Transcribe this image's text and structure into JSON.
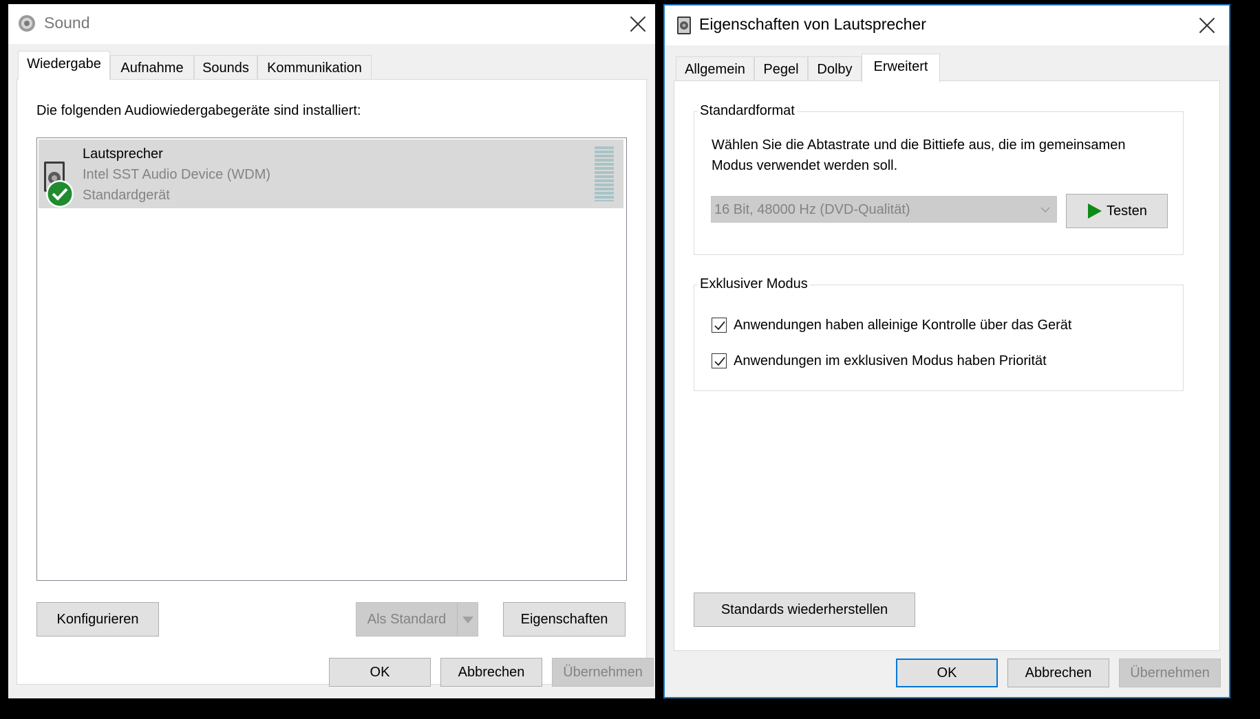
{
  "sound_dialog": {
    "title": "Sound",
    "tabs": [
      {
        "label": "Wiedergabe",
        "active": true
      },
      {
        "label": "Aufnahme",
        "active": false
      },
      {
        "label": "Sounds",
        "active": false
      },
      {
        "label": "Kommunikation",
        "active": false
      }
    ],
    "intro_text": "Die folgenden Audiowiedergabegeräte sind installiert:",
    "devices": [
      {
        "name": "Lautsprecher",
        "description": "Intel SST Audio Device (WDM)",
        "status": "Standardgerät",
        "icon": "speaker-icon",
        "status_icon": "default-device-check-icon"
      }
    ],
    "buttons": {
      "configure": "Konfigurieren",
      "set_default": "Als Standard",
      "properties": "Eigenschaften",
      "ok": "OK",
      "cancel": "Abbrechen",
      "apply": "Übernehmen"
    }
  },
  "properties_dialog": {
    "title": "Eigenschaften von Lautsprecher",
    "tabs": [
      {
        "label": "Allgemein",
        "active": false
      },
      {
        "label": "Pegel",
        "active": false
      },
      {
        "label": "Dolby",
        "active": false
      },
      {
        "label": "Erweitert",
        "active": true
      }
    ],
    "default_format": {
      "group_label": "Standardformat",
      "description_line1": "Wählen Sie die Abtastrate und die Bittiefe aus, die im gemeinsamen",
      "description_line2": "Modus verwendet werden soll.",
      "selected_format": "16 Bit, 48000 Hz (DVD-Qualität)",
      "test_button": "Testen"
    },
    "exclusive_mode": {
      "group_label": "Exklusiver Modus",
      "options": [
        {
          "label": "Anwendungen haben alleinige Kontrolle über das Gerät",
          "checked": true
        },
        {
          "label": "Anwendungen im exklusiven Modus haben Priorität",
          "checked": true
        }
      ]
    },
    "buttons": {
      "restore_defaults": "Standards wiederherstellen",
      "ok": "OK",
      "cancel": "Abbrechen",
      "apply": "Übernehmen"
    }
  },
  "colors": {
    "accent_border": "#1979ca",
    "check_green": "#1e8c2f",
    "play_green": "#0e8a16",
    "disabled_text": "#838383"
  }
}
